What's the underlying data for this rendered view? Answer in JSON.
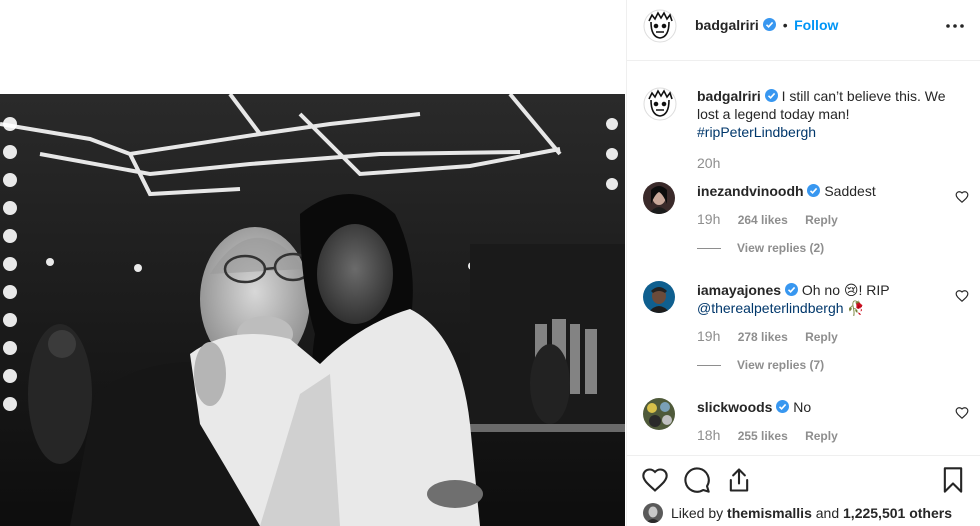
{
  "post": {
    "author": "badgalriri",
    "follow_label": "Follow",
    "dot": "•",
    "caption": "I still can’t believe this. We lost a legend today man!",
    "hashtag": "#ripPeterLindbergh",
    "caption_time": "20h"
  },
  "comments": [
    {
      "user": "inezandvinoodh",
      "text": "Saddest",
      "time": "19h",
      "likes": "264 likes",
      "reply": "Reply",
      "view_replies": "View replies (2)"
    },
    {
      "user": "iamayajones",
      "text_before": "Oh no ",
      "emoji": "😢",
      "text_after": "! RIP",
      "mention": "@therealpeterlindbergh",
      "emoji2": "🥀",
      "time": "19h",
      "likes": "278 likes",
      "reply": "Reply",
      "view_replies": "View replies (7)"
    },
    {
      "user": "slickwoods",
      "text": "No",
      "time": "18h",
      "likes": "255 likes",
      "reply": "Reply"
    }
  ],
  "likes_bar": {
    "prefix": "Liked by",
    "user": "themismallis",
    "joiner": "and",
    "count": "1,225,501 others"
  },
  "colors": {
    "verified": "#3897f0",
    "link": "#00376b",
    "follow": "#0095f6",
    "muted": "#8e8e8e"
  },
  "icons": [
    "verified-badge-icon",
    "more-options-icon",
    "heart-icon",
    "comment-icon",
    "share-icon",
    "bookmark-icon"
  ]
}
